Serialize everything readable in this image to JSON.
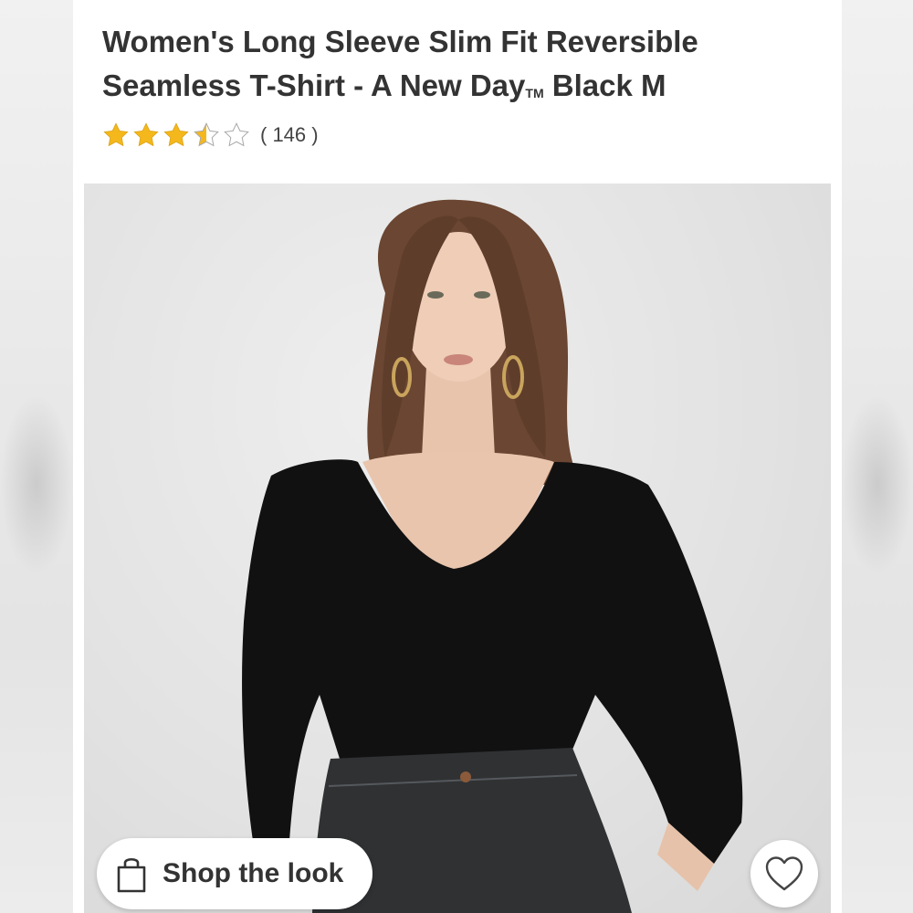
{
  "product": {
    "title_main": "Women's Long Sleeve Slim Fit Reversible Seamless T-Shirt - A New Day",
    "trademark": "TM",
    "title_variant": " Black M",
    "rating_value": 3.5,
    "rating_max": 5,
    "review_count": "( 146 )"
  },
  "actions": {
    "shop_the_look": "Shop the look",
    "favorite_icon": "heart-icon",
    "bag_icon": "shopping-bag-icon"
  },
  "colors": {
    "star_fill": "#f5b81c",
    "star_outline": "#a9a9a9",
    "title_text": "#333333",
    "shirt": "#111111",
    "jeans": "#2f3133"
  }
}
